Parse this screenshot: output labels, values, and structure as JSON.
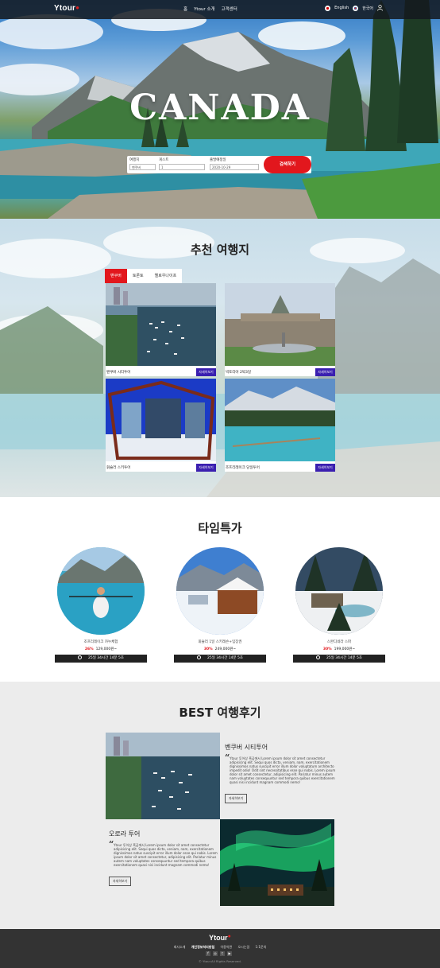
{
  "header": {
    "logo": "Ytour",
    "nav": [
      "홈",
      "Ytour 소개",
      "고객센터"
    ],
    "lang_en": "English",
    "lang_ko": "한국어"
  },
  "hero": {
    "title": "CANADA",
    "search": {
      "dest_label": "여행지",
      "dest_value": "밴쿠버",
      "guest_label": "게스트",
      "guest_value": "1",
      "date_label": "출발예정일",
      "date_value": "2020-10-29",
      "button": "검색하기"
    }
  },
  "recommend": {
    "title": "추천 여행지",
    "tabs": [
      "밴쿠버",
      "토론토",
      "옐로우나이프"
    ],
    "more_label": "자세히보기",
    "cards": [
      {
        "name": "밴쿠버 시티투어"
      },
      {
        "name": "빅토리아 2박3일"
      },
      {
        "name": "휘슬러 스키투어"
      },
      {
        "name": "조프리레이크 당일투어"
      }
    ]
  },
  "timedeal": {
    "title": "타임특가",
    "items": [
      {
        "name": "조프리레이크 카누체험",
        "discount": "26%",
        "price": "129,000원~",
        "timer": "25일 34시간 14분 5초"
      },
      {
        "name": "휘슬러 1일 스키레슨+입장권",
        "discount": "30%",
        "price": "249,000원~",
        "timer": "25일 34시간 14분 5초"
      },
      {
        "name": "스완디네라 스파",
        "discount": "30%",
        "price": "199,000원~",
        "timer": "25일 34시간 14분 5초"
      }
    ]
  },
  "review": {
    "title": "BEST 여행후기",
    "items": [
      {
        "title": "벤쿠버 시티투어",
        "body": "Ytour 투어상 흑곰에서 Lorem ipsum dolor sit amet consectetur adipisicing elit. Sequi quos dicta, veniam, nam, exercitationem dignissimos natus suscipit error illum dolor voluptatum architecto impedit odio! Odit sint necessitatibus esse qui nobis. Lorem ipsum dolor sit amet consectetur, adipisicing elit. Pariatur minus autem nam voluptates consequuntur sed tempora quibus exercitationem quasi nisi incidunt magnam commodi nemo!",
        "button": "자세히보기"
      },
      {
        "title": "오로라 투어",
        "body": "Ytour 투어상 흑곰에서 Lorem ipsum dolor sit amet consectetur adipisicing elit. Sequi quos dicta, veniam, nam, exercitationem dignissimos natus suscipit error illum dolor esse qui nobis. Lorem ipsum dolor sit amet consectetur, adipisicing elit. Pariatur minus autem nam voluptates consequuntur sed tempora quibus exercitationem quasi nisi incidunt magnam commodi nemo!",
        "button": "자세히보기"
      }
    ]
  },
  "footer": {
    "logo": "Ytour",
    "links": [
      "회사소개",
      "개인정보처리방침",
      "이용약관",
      "오시는길",
      "1:1문의"
    ],
    "copyright": "© Ytour.All Rights Reserved."
  }
}
